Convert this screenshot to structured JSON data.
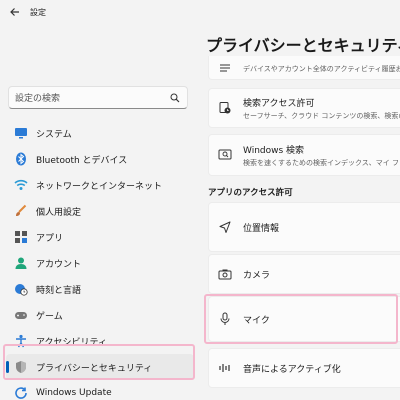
{
  "app": {
    "title": "設定"
  },
  "search": {
    "placeholder": "設定の検索"
  },
  "sidebar": {
    "items": [
      {
        "label": "システム",
        "icon": "monitor-icon"
      },
      {
        "label": "Bluetooth とデバイス",
        "icon": "bluetooth-icon"
      },
      {
        "label": "ネットワークとインターネット",
        "icon": "wifi-icon"
      },
      {
        "label": "個人用設定",
        "icon": "brush-icon"
      },
      {
        "label": "アプリ",
        "icon": "apps-icon"
      },
      {
        "label": "アカウント",
        "icon": "person-icon"
      },
      {
        "label": "時刻と言語",
        "icon": "globe-clock-icon"
      },
      {
        "label": "ゲーム",
        "icon": "gamepad-icon"
      },
      {
        "label": "アクセシビリティ",
        "icon": "accessibility-icon"
      },
      {
        "label": "プライバシーとセキュリティ",
        "icon": "shield-icon",
        "active": true
      },
      {
        "label": "Windows Update",
        "icon": "update-icon"
      }
    ]
  },
  "main": {
    "title": "プライバシーとセキュリティ",
    "cards": [
      {
        "title": "",
        "subtitle": "デバイスやアカウント全体のアクティビティ履歴およ",
        "icon": "history-icon"
      },
      {
        "title": "検索アクセス許可",
        "subtitle": "セーフサーチ、クラウド コンテンツの検索、検索の履",
        "icon": "search-lock-icon"
      },
      {
        "title": "Windows 検索",
        "subtitle": "検索を速くするための検索インデックス、マイ ファイ",
        "icon": "search-index-icon"
      }
    ],
    "section_heading": "アプリのアクセス許可",
    "app_permissions": [
      {
        "title": "位置情報",
        "icon": "location-icon"
      },
      {
        "title": "カメラ",
        "icon": "camera-icon"
      },
      {
        "title": "マイク",
        "icon": "microphone-icon"
      },
      {
        "title": "音声によるアクティブ化",
        "icon": "voice-activation-icon"
      }
    ]
  },
  "colors": {
    "accent": "#005fb8",
    "highlight": "#f4b6cc",
    "background": "#f3f3f3",
    "card": "#fbfbfb"
  }
}
